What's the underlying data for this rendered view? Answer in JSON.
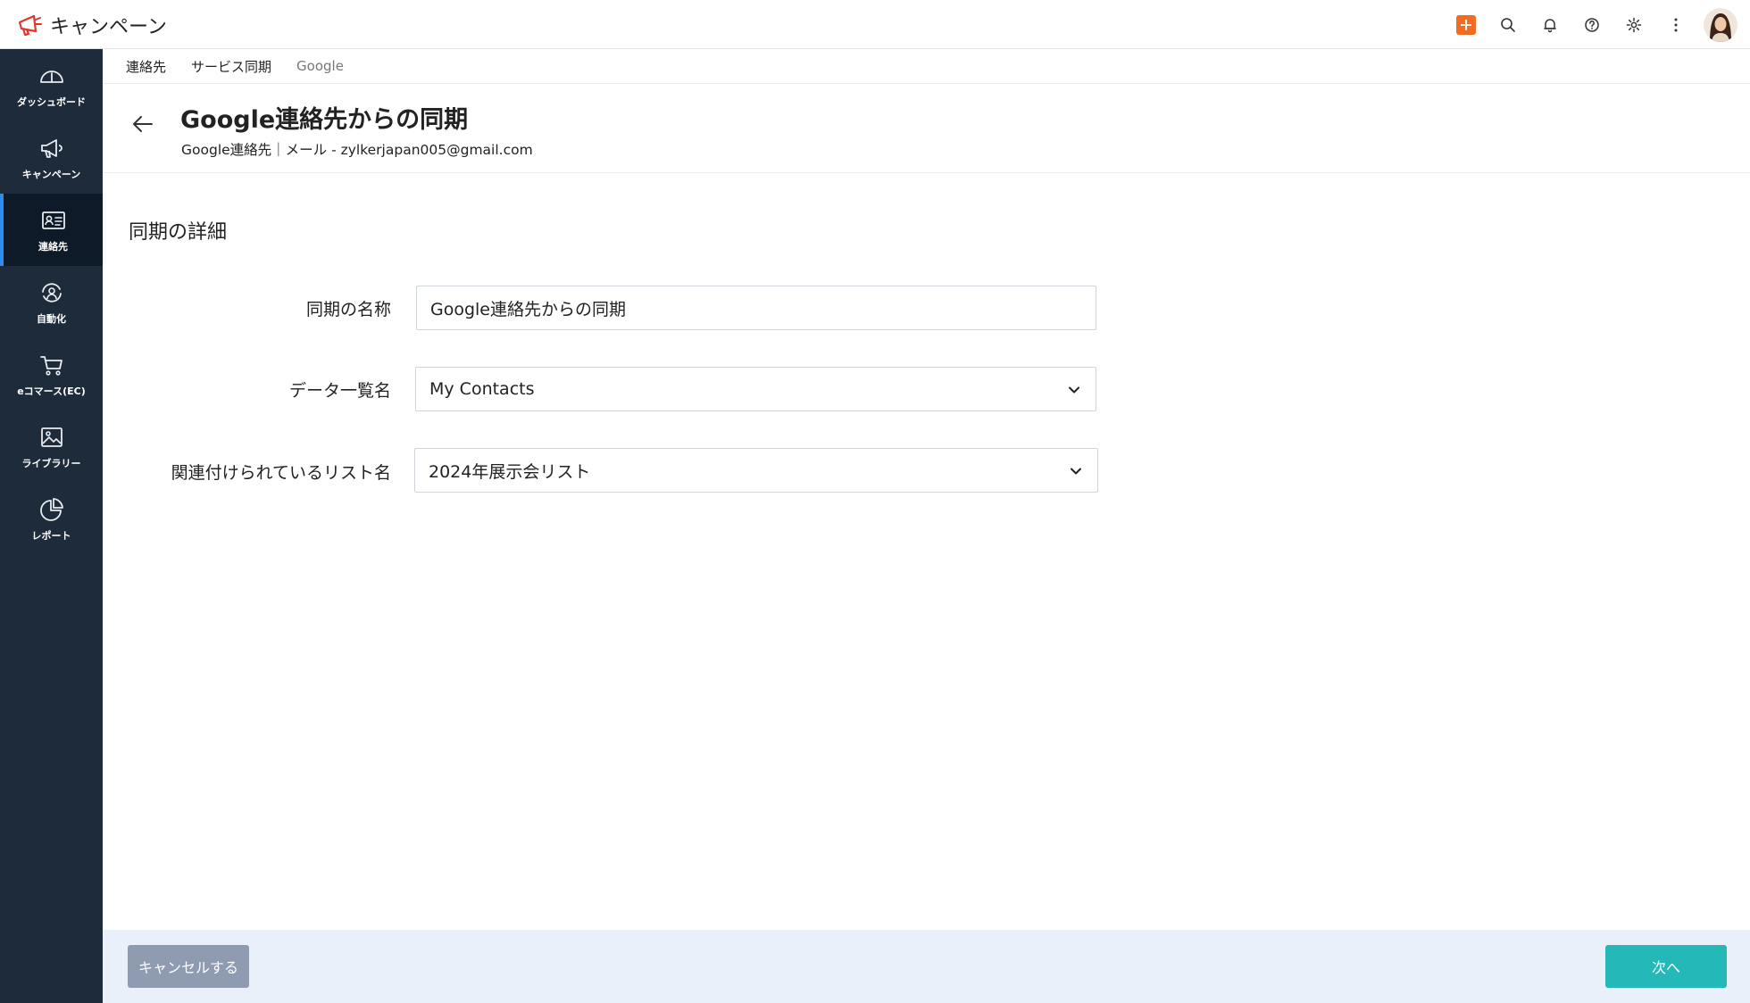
{
  "app": {
    "title": "キャンペーン"
  },
  "sidebar": {
    "items": [
      {
        "label": "ダッシュボード",
        "icon": "dashboard-gauge-icon",
        "active": false
      },
      {
        "label": "キャンペーン",
        "icon": "megaphone-icon",
        "active": false
      },
      {
        "label": "連絡先",
        "icon": "contact-card-icon",
        "active": true
      },
      {
        "label": "自動化",
        "icon": "automation-icon",
        "active": false
      },
      {
        "label": "eコマース(EC)",
        "icon": "cart-icon",
        "active": false
      },
      {
        "label": "ライブラリー",
        "icon": "image-library-icon",
        "active": false
      },
      {
        "label": "レポート",
        "icon": "pie-chart-icon",
        "active": false
      }
    ]
  },
  "breadcrumb": {
    "items": [
      "連絡先",
      "サービス同期",
      "Google"
    ]
  },
  "header": {
    "title": "Google連絡先からの同期",
    "subtitle": "Google連絡先｜メール - zylkerjapan005@gmail.com"
  },
  "section": {
    "title": "同期の詳細"
  },
  "form": {
    "sync_name": {
      "label": "同期の名称",
      "value": "Google連絡先からの同期"
    },
    "data_list": {
      "label": "データ一覧名",
      "value": "My Contacts"
    },
    "linked_list": {
      "label": "関連付けられているリスト名",
      "value": "2024年展示会リスト"
    }
  },
  "footer": {
    "cancel_label": "キャンセルする",
    "next_label": "次へ"
  },
  "colors": {
    "accent": "#24b8b8",
    "sidebar": "#1e2b3b",
    "active_bar": "#2d8cf0",
    "quick_create": "#f26b21",
    "footer_bg": "#e9f0fa"
  }
}
